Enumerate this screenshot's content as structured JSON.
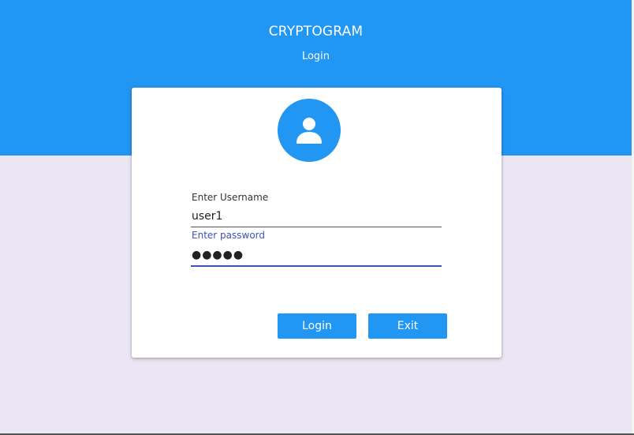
{
  "header": {
    "title": "CRYPTOGRAM",
    "subtitle": "Login",
    "color": "#2196f3"
  },
  "form": {
    "avatar_icon": "user-icon",
    "username": {
      "label": "Enter Username",
      "value": "user1"
    },
    "password": {
      "label": "Enter password",
      "value": "●●●●●"
    },
    "login_label": "Login",
    "exit_label": "Exit"
  },
  "colors": {
    "accent": "#2196f3",
    "focus": "#3f51b5",
    "background": "#ece6f4"
  }
}
